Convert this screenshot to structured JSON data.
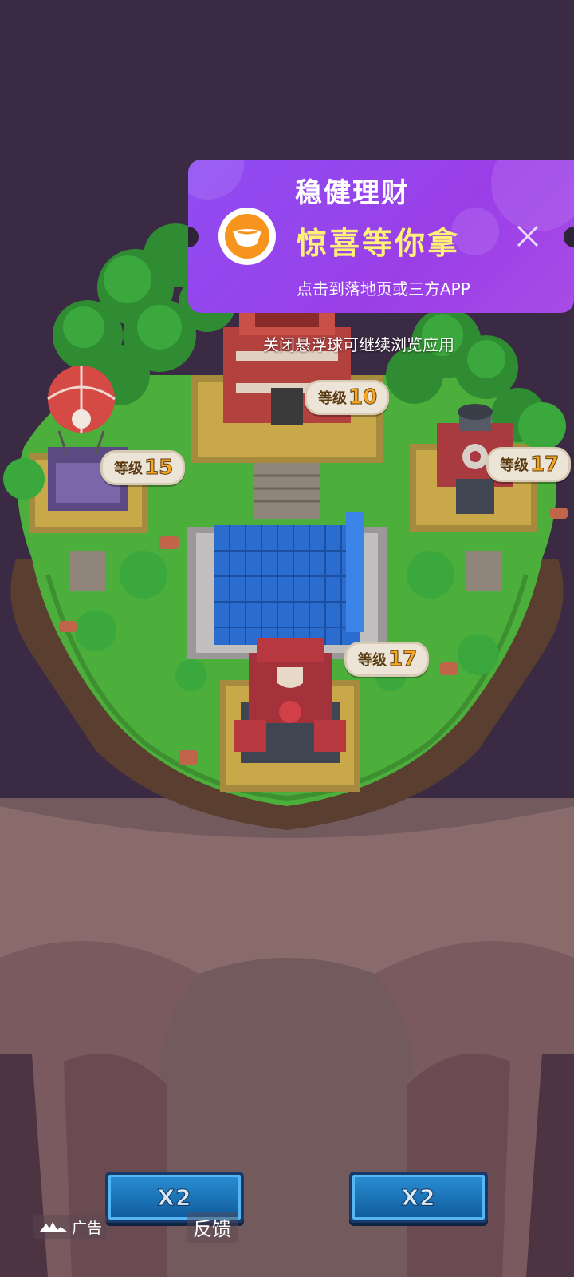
{
  "ad": {
    "title": "稳健理财",
    "headline": "惊喜等你拿",
    "subtitle": "点击到落地页或三方APP",
    "icon": "gold-ingot-icon",
    "close_icon": "close-icon",
    "hint": "关闭悬浮球可继续浏览应用"
  },
  "buildings": [
    {
      "name": "town-hall",
      "level_label": "等级",
      "level": "10"
    },
    {
      "name": "balloon-tower",
      "level_label": "等级",
      "level": "15"
    },
    {
      "name": "workshop",
      "level_label": "等级",
      "level": "17"
    },
    {
      "name": "cannon",
      "level_label": "等级",
      "level": "17"
    }
  ],
  "buttons": {
    "left_multiplier": "X2",
    "right_multiplier": "X2"
  },
  "footer": {
    "ad_label": "广告",
    "feedback": "反馈"
  },
  "colors": {
    "ad_purple": "#9a3fe8",
    "headline_yellow": "#fff176",
    "grass": "#4caf3c",
    "cliff": "#7e5c5c",
    "sky": "#3a2a44",
    "level_number": "#f5a623"
  }
}
